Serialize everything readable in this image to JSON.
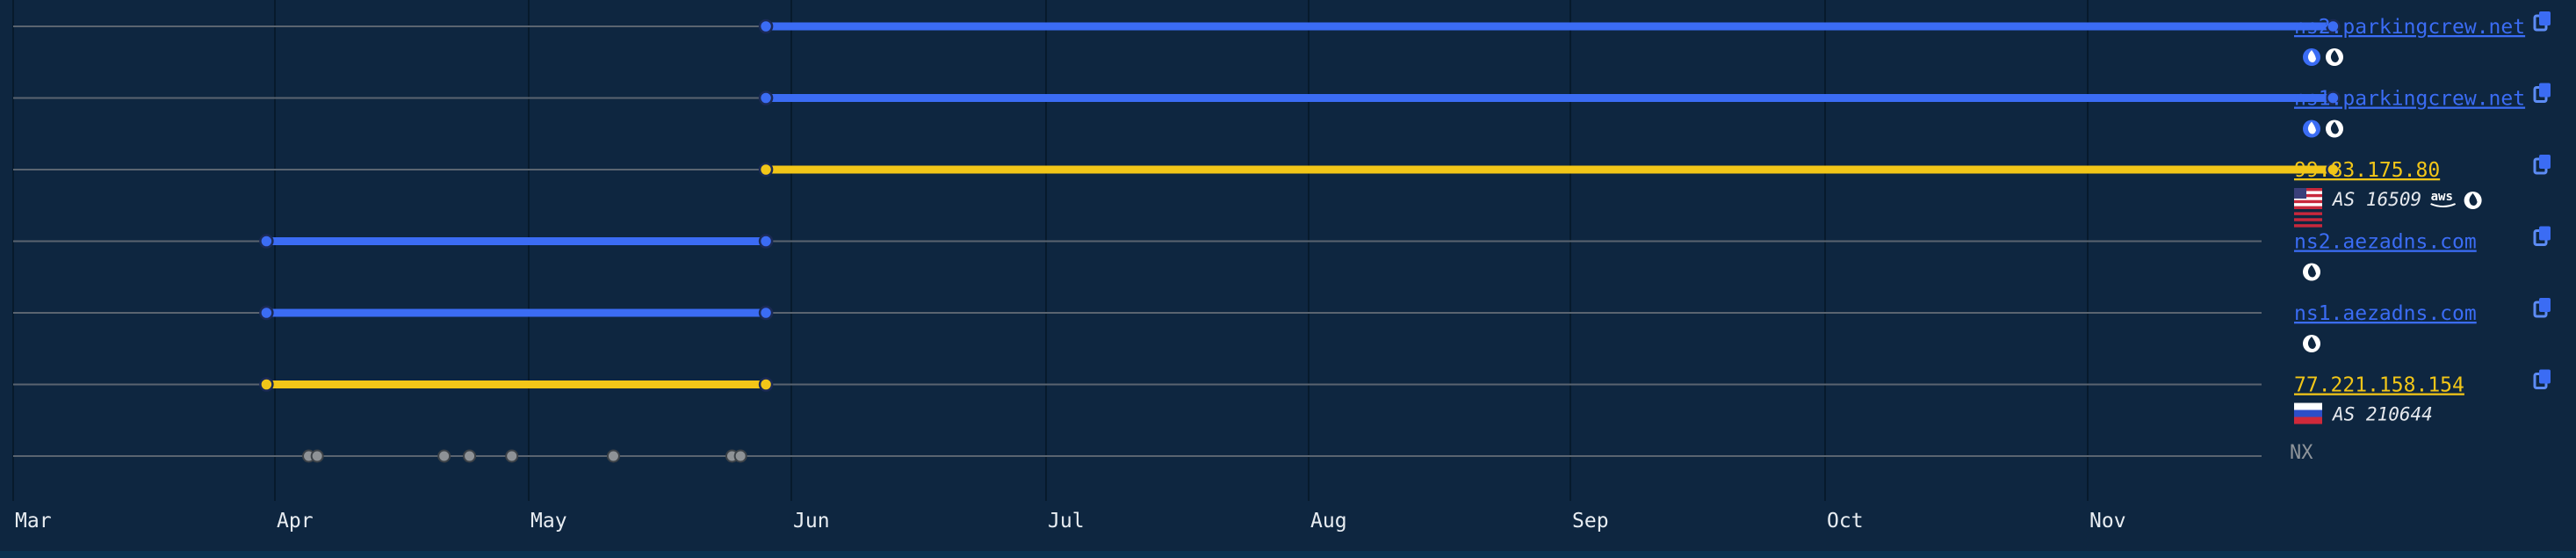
{
  "chart_data": {
    "type": "timeline",
    "x_axis": {
      "ticks": [
        "Mar",
        "Apr",
        "May",
        "Jun",
        "Jul",
        "Aug",
        "Sep",
        "Oct",
        "Nov"
      ],
      "range": [
        "Mar 1",
        "Nov 30"
      ]
    },
    "grid": true,
    "rows": [
      {
        "label": "ns2.parkingcrew.net",
        "kind": "nameserver",
        "color": "#3b6cf4",
        "start": "May 29",
        "end": "Nov 30",
        "icons": [
          "blue-flame-icon",
          "white-flame-icon"
        ],
        "copy": true
      },
      {
        "label": "ns1.parkingcrew.net",
        "kind": "nameserver",
        "color": "#3b6cf4",
        "start": "May 29",
        "end": "Nov 30",
        "icons": [
          "blue-flame-icon",
          "white-flame-icon"
        ],
        "copy": true
      },
      {
        "label": "99.83.175.80",
        "kind": "ip",
        "color": "#f2c618",
        "start": "May 29",
        "end": "Nov 30",
        "flag": "us-flag-icon",
        "asn": "AS 16509",
        "icons": [
          "aws-icon",
          "white-flame-icon"
        ],
        "copy": true
      },
      {
        "label": "ns2.aezadns.com",
        "kind": "nameserver",
        "color": "#3b6cf4",
        "start": "Mar 31",
        "end": "May 29",
        "icons": [
          "white-flame-icon"
        ],
        "copy": true
      },
      {
        "label": "ns1.aezadns.com",
        "kind": "nameserver",
        "color": "#3b6cf4",
        "start": "Mar 31",
        "end": "May 29",
        "icons": [
          "white-flame-icon"
        ],
        "copy": true
      },
      {
        "label": "77.221.158.154",
        "kind": "ip",
        "color": "#f2c618",
        "start": "Mar 31",
        "end": "May 29",
        "flag": "ru-flag-icon",
        "asn": "AS 210644",
        "icons": [],
        "copy": true
      },
      {
        "label": "NX",
        "kind": "nx",
        "color": "#9aa0a6",
        "points": [
          "Apr 5",
          "Apr 6",
          "Apr 21",
          "Apr 24",
          "Apr 29",
          "May 11",
          "May 25",
          "May 26"
        ]
      }
    ]
  },
  "colors": {
    "background": "#0e2640",
    "grid": "#3a4a5c",
    "row_line": "#5a6470",
    "nameserver": "#3b6cf4",
    "ip": "#f2c618",
    "nx": "#9aa0a6",
    "tick_text": "#e8edf2"
  }
}
